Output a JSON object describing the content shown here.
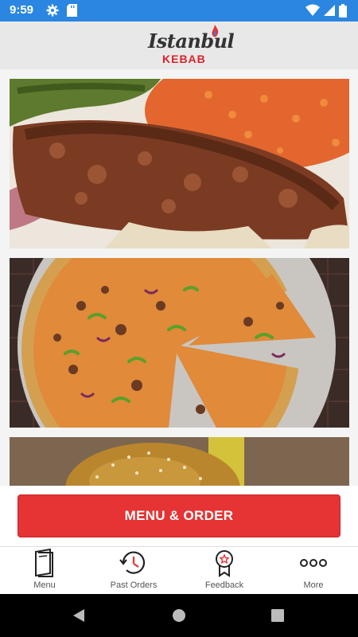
{
  "status_bar": {
    "time": "9:59",
    "icons": [
      "gear-icon",
      "sd-card-icon",
      "wifi-icon",
      "signal-icon",
      "battery-icon"
    ]
  },
  "header": {
    "logo_line1": "Istanbul",
    "logo_line2": "KEBAB"
  },
  "gallery": [
    {
      "subject": "kebab-photo"
    },
    {
      "subject": "pizza-photo"
    },
    {
      "subject": "burger-photo"
    }
  ],
  "order_button": {
    "label": "MENU & ORDER",
    "color": "#e63333"
  },
  "tabs": [
    {
      "label": "Menu",
      "icon": "menu-book-icon"
    },
    {
      "label": "Past Orders",
      "icon": "history-clock-icon"
    },
    {
      "label": "Feedback",
      "icon": "award-ribbon-icon"
    },
    {
      "label": "More",
      "icon": "more-dots-icon"
    }
  ],
  "nav": {
    "icons": [
      "back-icon",
      "home-icon",
      "recents-icon"
    ]
  },
  "colors": {
    "status_bar": "#2a86e0",
    "accent": "#e63333"
  }
}
